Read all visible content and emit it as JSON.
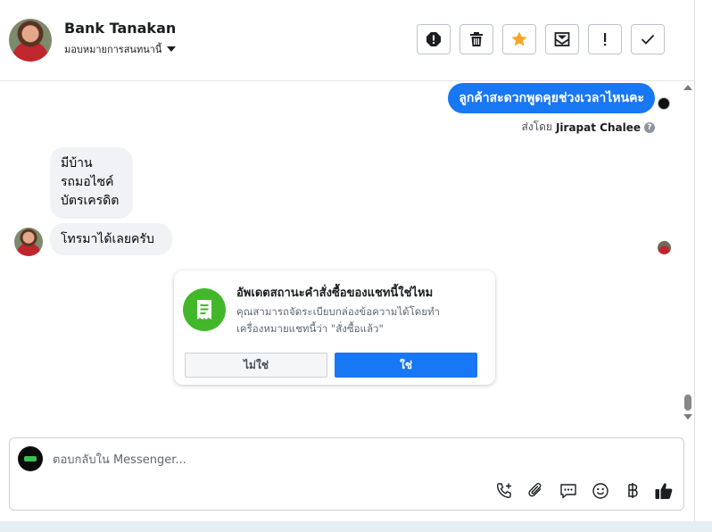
{
  "header": {
    "contact_name": "Bank Tanakan",
    "assign_label": "มอบหมายการสนทนานี้",
    "toolbar": [
      {
        "name": "report-spam-button",
        "icon": "alert-circle-icon"
      },
      {
        "name": "delete-button",
        "icon": "trash-icon"
      },
      {
        "name": "star-button",
        "icon": "star-icon"
      },
      {
        "name": "mark-unread-button",
        "icon": "envelope-icon"
      },
      {
        "name": "follow-up-button",
        "icon": "exclamation-icon"
      },
      {
        "name": "mark-done-button",
        "icon": "checkmark-icon"
      }
    ]
  },
  "conversation": {
    "outgoing_message": "ลูกค้าสะดวกพูดคุยช่วงเวลาไหนคะ",
    "sent_by_prefix": "ส่งโดย",
    "sent_by_name": "Jirapat Chalee",
    "sent_by_help": "?",
    "incoming_message_1": [
      "มีบ้าน",
      "รถมอไซค์",
      "บัตรเครดิต"
    ],
    "incoming_message_2": "โทรมาได้เลยครับ"
  },
  "order_card": {
    "title": "อัพเดตสถานะคำสั่งซื้อของแชทนี้ใช่ไหม",
    "description_line1": "คุณสามารถจัดระเบียบกล่องข้อความได้โดยทำ",
    "description_line2": "เครื่องหมายแชทนี้ว่า \"สั่งซื้อแล้ว\"",
    "no_label": "ไม่ใช่",
    "yes_label": "ใช่"
  },
  "composer": {
    "placeholder": "ตอบกลับใน Messenger...",
    "actions": [
      "phone-plus-icon",
      "paperclip-icon",
      "chat-bubble-icon",
      "smiley-icon",
      "baht-icon",
      "thumbs-up-icon"
    ]
  },
  "colors": {
    "accent": "#1877f2",
    "star": "#f5a623",
    "card_icon": "#42b72a"
  }
}
